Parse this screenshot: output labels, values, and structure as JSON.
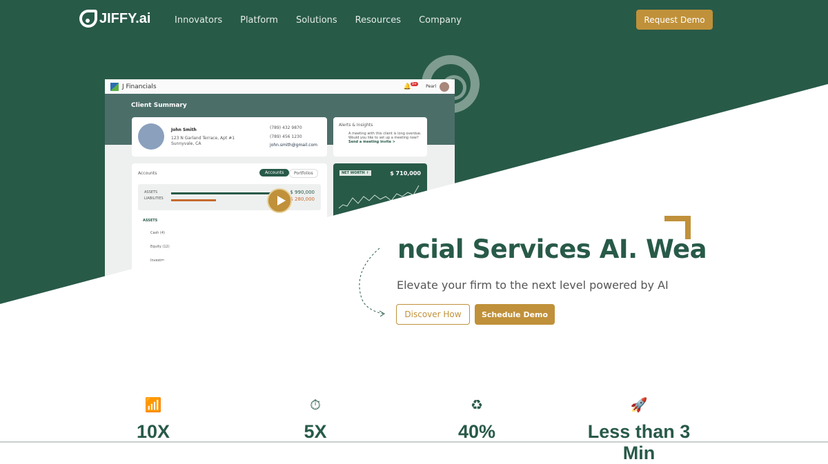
{
  "nav": {
    "brand": "JIFFY.ai",
    "items": [
      "Innovators",
      "Platform",
      "Solutions",
      "Resources",
      "Company"
    ],
    "cta": "Request Demo"
  },
  "mockup": {
    "app_name": "J Financials",
    "notif_badge": "9+",
    "user": "Pearl",
    "section_title": "Client Summary",
    "client": {
      "name": "John Smith",
      "address1": "123 N Garland Terrace, Apt #1",
      "address2": "Sunnyvale, CA",
      "phone1": "(789) 432 9870",
      "phone2": "(789) 456 1230",
      "email": "john.smith@gmail.com"
    },
    "alerts": {
      "title": "Alerts & Insights",
      "text": "A meeting with this client is long overdue. Would you like to set up a meeting now?",
      "link": "Send a meeting invite >"
    },
    "accounts": {
      "title": "Accounts",
      "tabs": [
        "Accounts",
        "Portfolios"
      ],
      "assets_label": "ASSETS",
      "liabilities_label": "LIABILITIES",
      "assets_value": "$ 990,000",
      "liabilities_value": "$ 280,000",
      "section": "ASSETS",
      "rows": [
        "Cash (4)",
        "Equity (12)",
        "Investm..."
      ]
    },
    "net_worth": {
      "label": "NET WORTH ↑",
      "value": "$ 710,000"
    }
  },
  "hero": {
    "headline": "ncial Services AI.  Wea",
    "subtitle": "Elevate your firm to the next level powered by AI",
    "discover": "Discover How",
    "schedule": "Schedule Demo"
  },
  "colors": {
    "brand_green": "#285a48",
    "accent_gold": "#c0913a"
  },
  "stats": [
    {
      "icon": "growth-chart-icon",
      "value": "10X"
    },
    {
      "icon": "stopwatch-icon",
      "value": "5X"
    },
    {
      "icon": "dollar-cycle-icon",
      "value": "40%"
    },
    {
      "icon": "rocket-icon",
      "value": "Less than 3 Min"
    }
  ]
}
